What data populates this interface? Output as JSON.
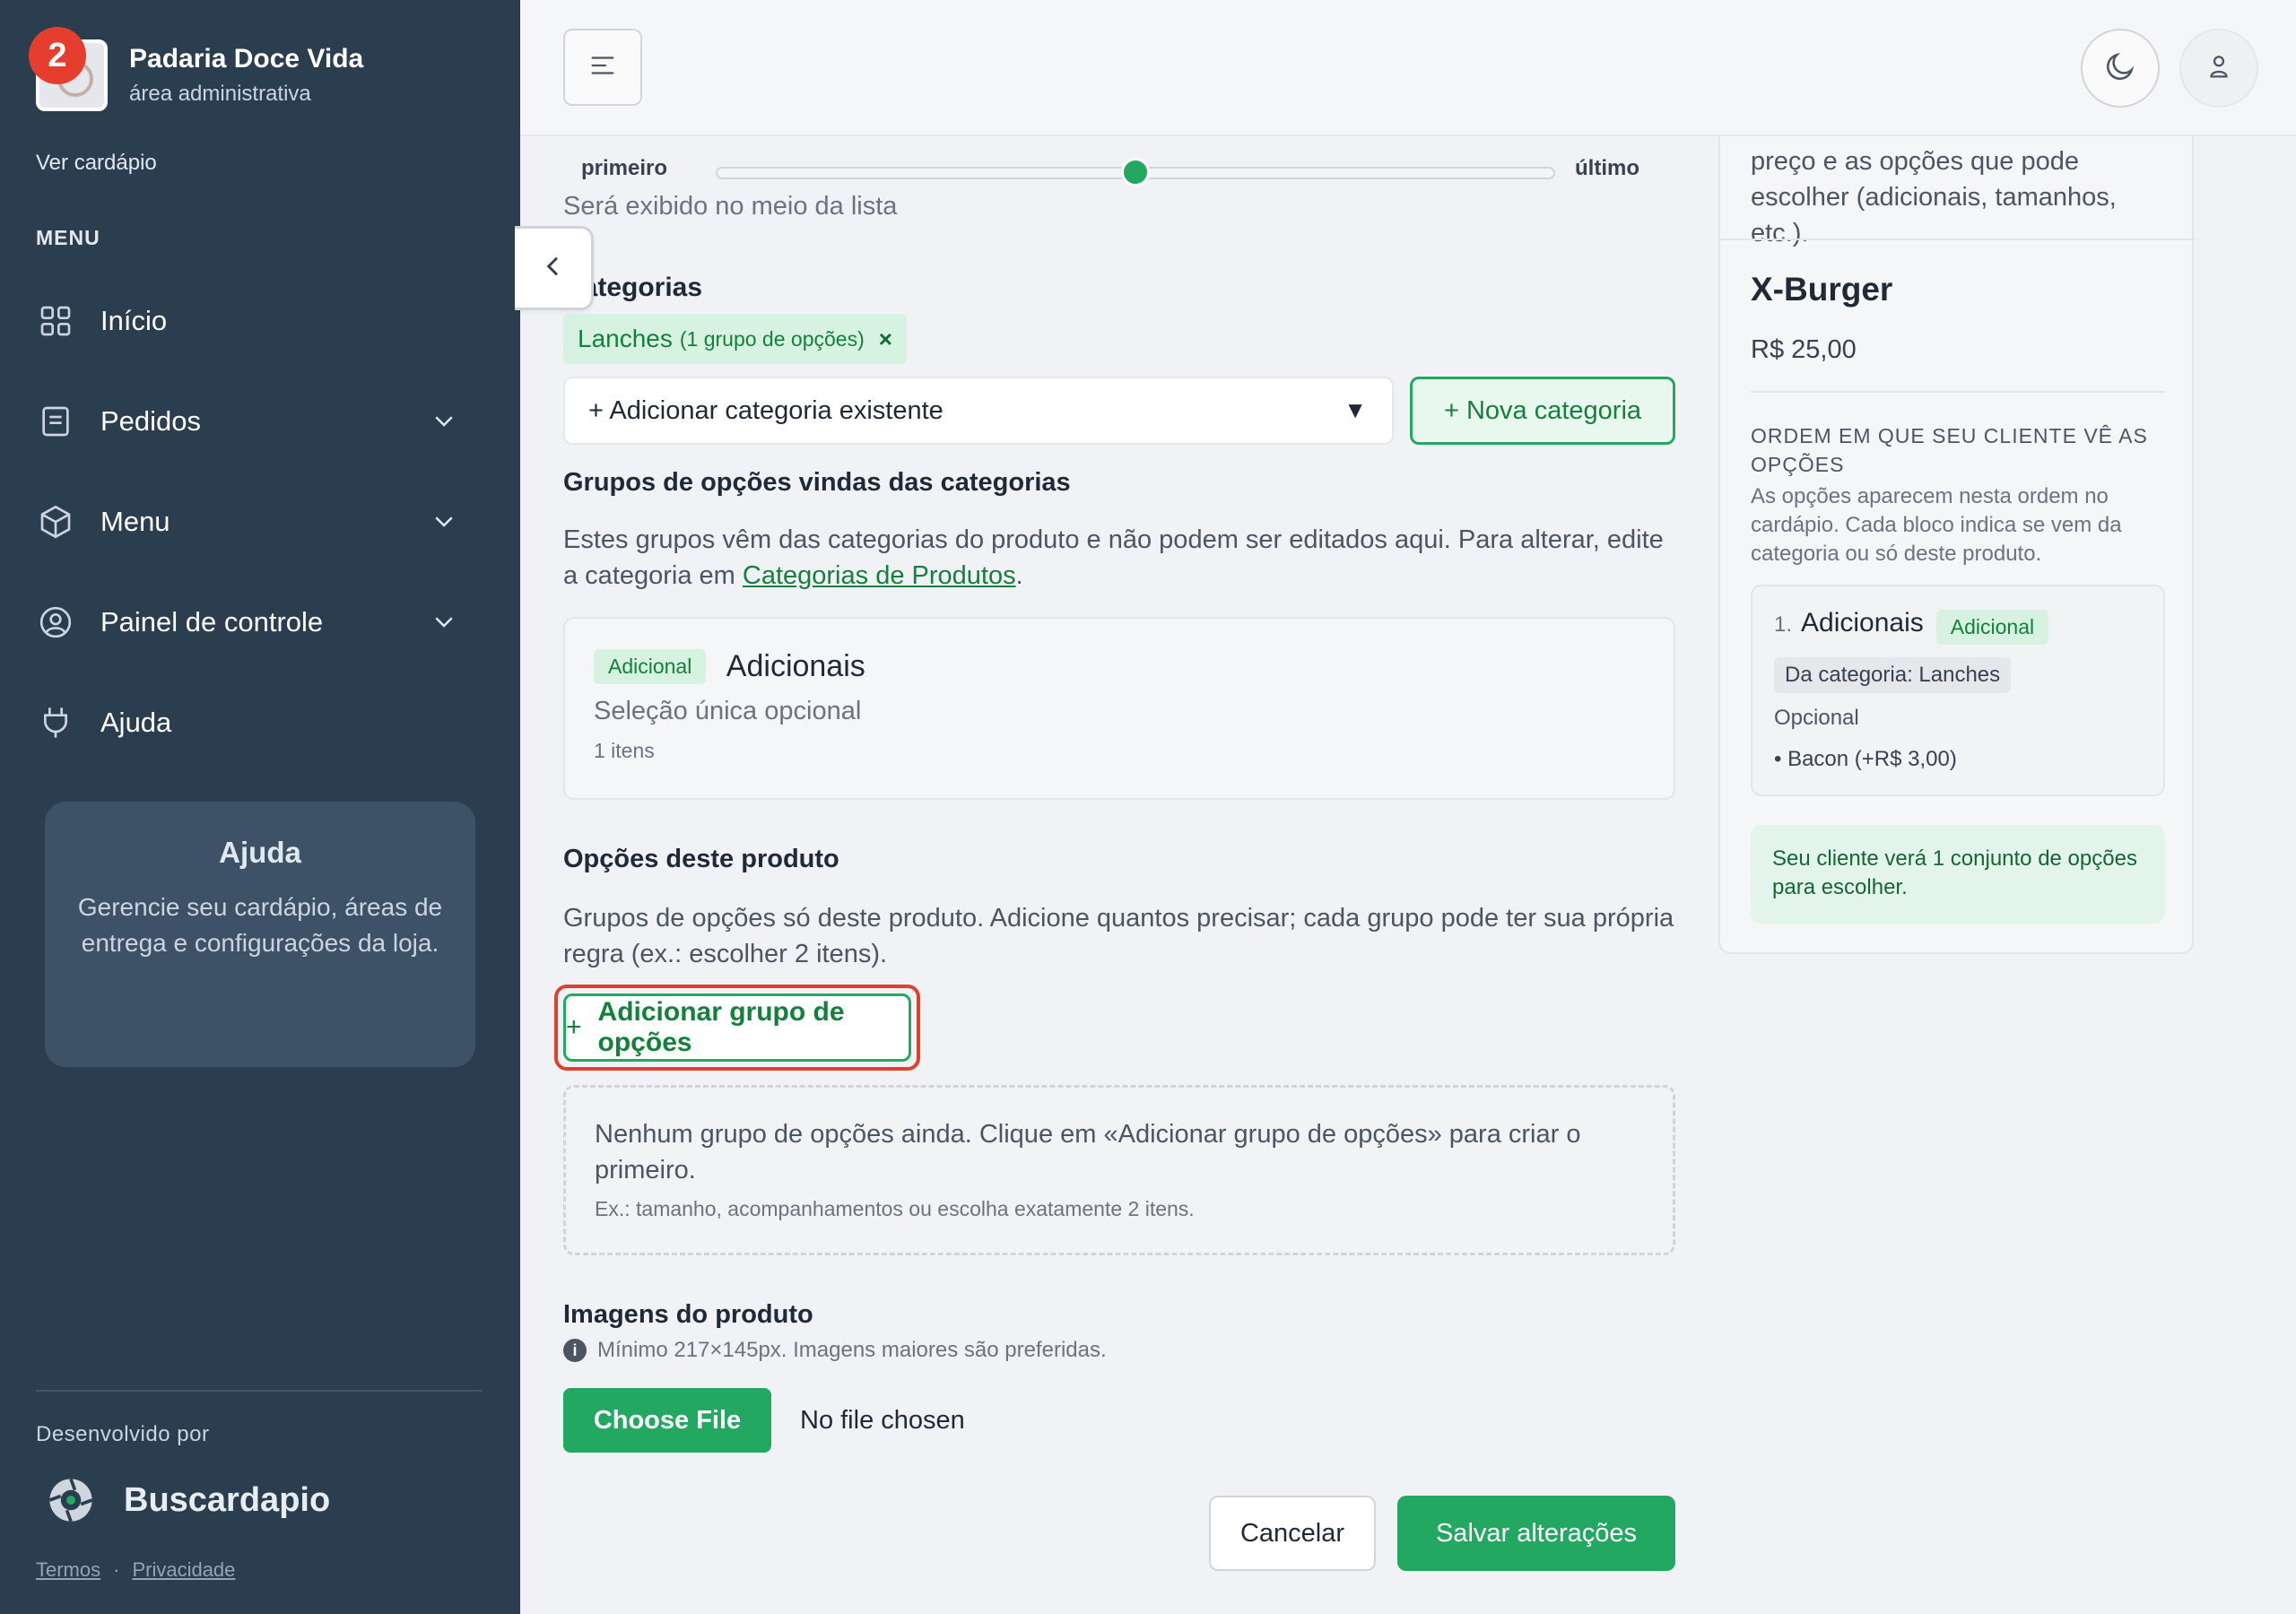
{
  "sidebar": {
    "brand_name": "Padaria Doce Vida",
    "brand_sub": "área administrativa",
    "notif_count": "2",
    "view_menu": "Ver cardápio",
    "menu_label": "MENU",
    "items": [
      {
        "label": "Início",
        "icon": "grid-icon"
      },
      {
        "label": "Pedidos",
        "icon": "receipt-icon"
      },
      {
        "label": "Menu",
        "icon": "box-icon"
      },
      {
        "label": "Painel de controle",
        "icon": "user-circle-icon"
      },
      {
        "label": "Ajuda",
        "icon": "plug-icon"
      }
    ],
    "help_title": "Ajuda",
    "help_text": "Gerencie seu cardápio, áreas de entrega e configurações da loja.",
    "dev_label": "Desenvolvido por",
    "dev_brand": "Buscardapio",
    "terms": "Termos",
    "privacy": "Privacidade"
  },
  "form": {
    "slider_first": "primeiro",
    "slider_last": "último",
    "slider_value": 0.5,
    "slider_helper": "Será exibido no meio da lista",
    "categories_label": "Categorias",
    "chip_name": "Lanches",
    "chip_detail": "(1 grupo de opções)",
    "chip_remove": "×",
    "select_placeholder": "+ Adicionar categoria existente",
    "new_category": "+ Nova categoria",
    "cat_groups_title": "Grupos de opções vindas das categorias",
    "cat_groups_desc": "Estes grupos vêm das categorias do produto e não podem ser editados aqui. Para alterar, edite a categoria em",
    "cat_groups_link": "Categorias de Produtos",
    "cat_card": {
      "tag": "Adicional",
      "title": "Adicionais",
      "subtitle": "Seleção única opcional",
      "count": "1 itens"
    },
    "own_options_title": "Opções deste produto",
    "own_options_desc": "Grupos de opções só deste produto. Adicione quantos precisar; cada grupo pode ter sua própria regra (ex.: escolher 2 itens).",
    "add_group_button": "Adicionar grupo de opções",
    "add_group_plus": "+",
    "empty_main": "Nenhum grupo de opções ainda. Clique em «Adicionar grupo de opções» para criar o primeiro.",
    "empty_example": "Ex.: tamanho, acompanhamentos ou escolha exatamente 2 itens.",
    "images_label": "Imagens do produto",
    "images_hint": "Mínimo 217×145px. Imagens maiores são preferidas.",
    "choose_file": "Choose File",
    "no_file": "No file chosen",
    "cancel": "Cancelar",
    "save": "Salvar alterações"
  },
  "preview": {
    "intro": "preço e as opções que pode escolher (adicionais, tamanhos, etc.).",
    "product_name": "X-Burger",
    "price": "R$ 25,00",
    "order_title": "ORDEM EM QUE SEU CLIENTE VÊ AS OPÇÕES",
    "order_desc": "As opções aparecem nesta ordem no cardápio. Cada bloco indica se vem da categoria ou só deste produto.",
    "item": {
      "num": "1.",
      "name": "Adicionais",
      "tag": "Adicional",
      "source": "Da categoria: Lanches",
      "rule": "Opcional",
      "bullet": "• Bacon (+R$ 3,00)"
    },
    "summary": "Seu cliente verá 1 conjunto de opções para escolher."
  },
  "colors": {
    "sidebar_bg": "#2b3e50",
    "accent_green": "#22a861",
    "highlight_red": "#e0412c"
  }
}
